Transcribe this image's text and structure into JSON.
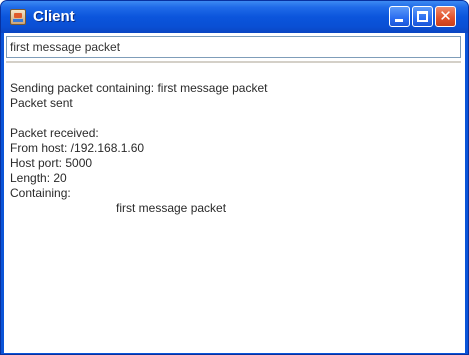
{
  "window": {
    "title": "Client",
    "icon": "java-app-icon",
    "controls": {
      "minimize": "minimize-icon",
      "maximize": "maximize-icon",
      "close": "close-icon",
      "close_glyph": "✕"
    }
  },
  "input": {
    "value": "first message packet"
  },
  "display": {
    "sending_line": "Sending packet containing: first message packet",
    "sent_line": "Packet sent",
    "received_line": "Packet received:",
    "from_host_line": "From host: /192.168.1.60",
    "host_port_line": "Host port: 5000",
    "length_line": "Length: 20",
    "containing_line": "Containing:",
    "containing_value": "first message packet"
  },
  "colors": {
    "titlebar": "#0a54d8",
    "close_button": "#e0502a",
    "input_border": "#7f9db9"
  }
}
